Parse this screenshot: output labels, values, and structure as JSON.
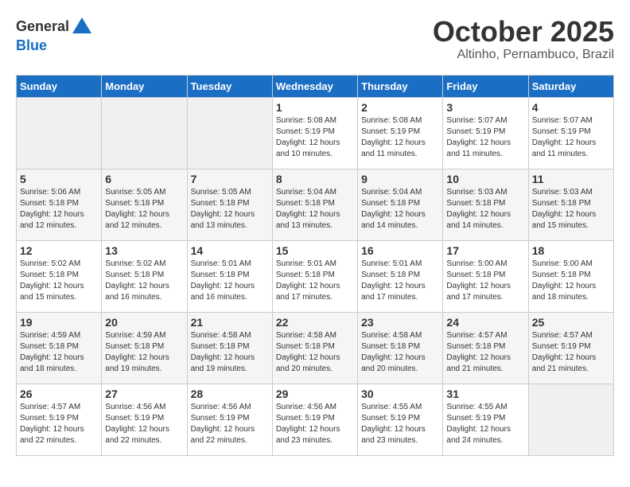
{
  "logo": {
    "text_general": "General",
    "text_blue": "Blue",
    "icon_color": "#1a6fc4"
  },
  "header": {
    "month": "October 2025",
    "location": "Altinho, Pernambuco, Brazil"
  },
  "weekdays": [
    "Sunday",
    "Monday",
    "Tuesday",
    "Wednesday",
    "Thursday",
    "Friday",
    "Saturday"
  ],
  "weeks": [
    [
      {
        "day": "",
        "info": ""
      },
      {
        "day": "",
        "info": ""
      },
      {
        "day": "",
        "info": ""
      },
      {
        "day": "1",
        "info": "Sunrise: 5:08 AM\nSunset: 5:19 PM\nDaylight: 12 hours\nand 10 minutes."
      },
      {
        "day": "2",
        "info": "Sunrise: 5:08 AM\nSunset: 5:19 PM\nDaylight: 12 hours\nand 11 minutes."
      },
      {
        "day": "3",
        "info": "Sunrise: 5:07 AM\nSunset: 5:19 PM\nDaylight: 12 hours\nand 11 minutes."
      },
      {
        "day": "4",
        "info": "Sunrise: 5:07 AM\nSunset: 5:19 PM\nDaylight: 12 hours\nand 11 minutes."
      }
    ],
    [
      {
        "day": "5",
        "info": "Sunrise: 5:06 AM\nSunset: 5:18 PM\nDaylight: 12 hours\nand 12 minutes."
      },
      {
        "day": "6",
        "info": "Sunrise: 5:05 AM\nSunset: 5:18 PM\nDaylight: 12 hours\nand 12 minutes."
      },
      {
        "day": "7",
        "info": "Sunrise: 5:05 AM\nSunset: 5:18 PM\nDaylight: 12 hours\nand 13 minutes."
      },
      {
        "day": "8",
        "info": "Sunrise: 5:04 AM\nSunset: 5:18 PM\nDaylight: 12 hours\nand 13 minutes."
      },
      {
        "day": "9",
        "info": "Sunrise: 5:04 AM\nSunset: 5:18 PM\nDaylight: 12 hours\nand 14 minutes."
      },
      {
        "day": "10",
        "info": "Sunrise: 5:03 AM\nSunset: 5:18 PM\nDaylight: 12 hours\nand 14 minutes."
      },
      {
        "day": "11",
        "info": "Sunrise: 5:03 AM\nSunset: 5:18 PM\nDaylight: 12 hours\nand 15 minutes."
      }
    ],
    [
      {
        "day": "12",
        "info": "Sunrise: 5:02 AM\nSunset: 5:18 PM\nDaylight: 12 hours\nand 15 minutes."
      },
      {
        "day": "13",
        "info": "Sunrise: 5:02 AM\nSunset: 5:18 PM\nDaylight: 12 hours\nand 16 minutes."
      },
      {
        "day": "14",
        "info": "Sunrise: 5:01 AM\nSunset: 5:18 PM\nDaylight: 12 hours\nand 16 minutes."
      },
      {
        "day": "15",
        "info": "Sunrise: 5:01 AM\nSunset: 5:18 PM\nDaylight: 12 hours\nand 17 minutes."
      },
      {
        "day": "16",
        "info": "Sunrise: 5:01 AM\nSunset: 5:18 PM\nDaylight: 12 hours\nand 17 minutes."
      },
      {
        "day": "17",
        "info": "Sunrise: 5:00 AM\nSunset: 5:18 PM\nDaylight: 12 hours\nand 17 minutes."
      },
      {
        "day": "18",
        "info": "Sunrise: 5:00 AM\nSunset: 5:18 PM\nDaylight: 12 hours\nand 18 minutes."
      }
    ],
    [
      {
        "day": "19",
        "info": "Sunrise: 4:59 AM\nSunset: 5:18 PM\nDaylight: 12 hours\nand 18 minutes."
      },
      {
        "day": "20",
        "info": "Sunrise: 4:59 AM\nSunset: 5:18 PM\nDaylight: 12 hours\nand 19 minutes."
      },
      {
        "day": "21",
        "info": "Sunrise: 4:58 AM\nSunset: 5:18 PM\nDaylight: 12 hours\nand 19 minutes."
      },
      {
        "day": "22",
        "info": "Sunrise: 4:58 AM\nSunset: 5:18 PM\nDaylight: 12 hours\nand 20 minutes."
      },
      {
        "day": "23",
        "info": "Sunrise: 4:58 AM\nSunset: 5:18 PM\nDaylight: 12 hours\nand 20 minutes."
      },
      {
        "day": "24",
        "info": "Sunrise: 4:57 AM\nSunset: 5:18 PM\nDaylight: 12 hours\nand 21 minutes."
      },
      {
        "day": "25",
        "info": "Sunrise: 4:57 AM\nSunset: 5:19 PM\nDaylight: 12 hours\nand 21 minutes."
      }
    ],
    [
      {
        "day": "26",
        "info": "Sunrise: 4:57 AM\nSunset: 5:19 PM\nDaylight: 12 hours\nand 22 minutes."
      },
      {
        "day": "27",
        "info": "Sunrise: 4:56 AM\nSunset: 5:19 PM\nDaylight: 12 hours\nand 22 minutes."
      },
      {
        "day": "28",
        "info": "Sunrise: 4:56 AM\nSunset: 5:19 PM\nDaylight: 12 hours\nand 22 minutes."
      },
      {
        "day": "29",
        "info": "Sunrise: 4:56 AM\nSunset: 5:19 PM\nDaylight: 12 hours\nand 23 minutes."
      },
      {
        "day": "30",
        "info": "Sunrise: 4:55 AM\nSunset: 5:19 PM\nDaylight: 12 hours\nand 23 minutes."
      },
      {
        "day": "31",
        "info": "Sunrise: 4:55 AM\nSunset: 5:19 PM\nDaylight: 12 hours\nand 24 minutes."
      },
      {
        "day": "",
        "info": ""
      }
    ]
  ]
}
